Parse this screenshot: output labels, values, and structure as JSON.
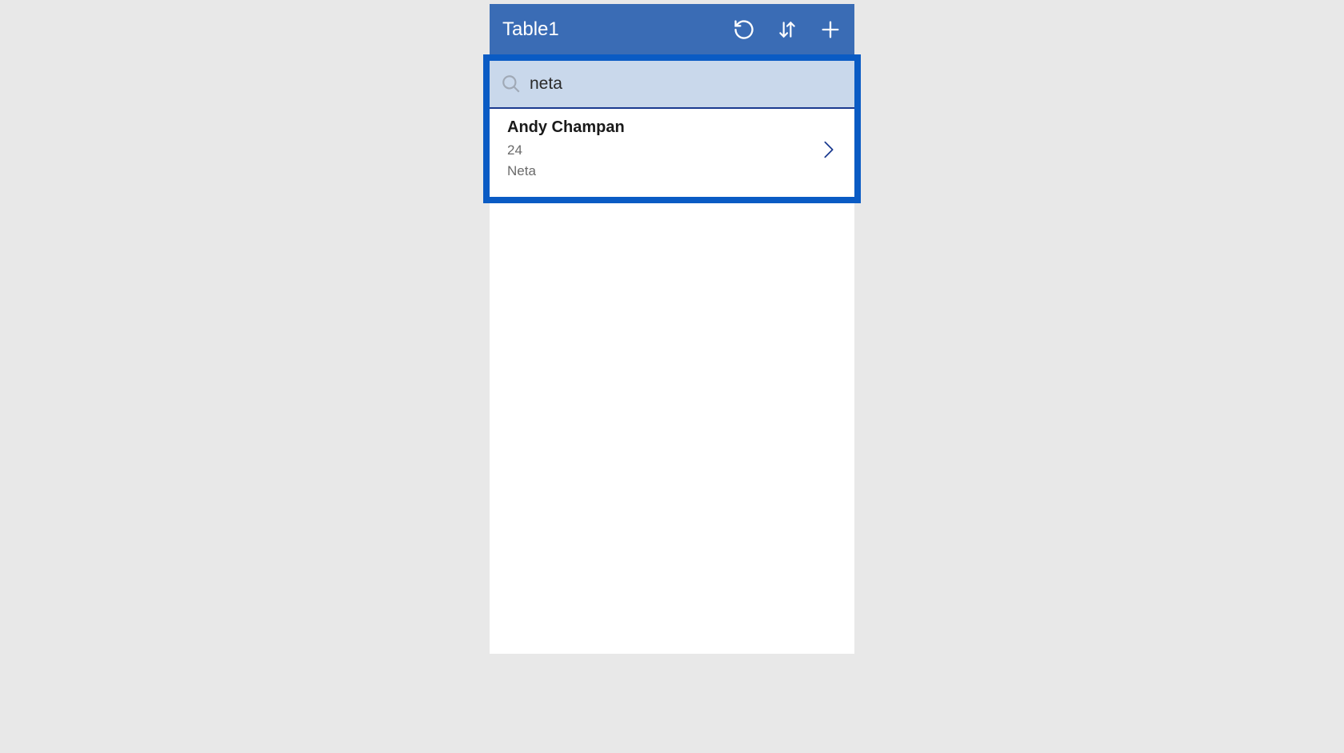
{
  "header": {
    "title": "Table1"
  },
  "search": {
    "value": "neta"
  },
  "results": [
    {
      "name": "Andy Champan",
      "age": "24",
      "company": "Neta"
    }
  ],
  "colors": {
    "headerBg": "#3a6cb5",
    "highlightBorder": "#0a5bc4",
    "searchBg": "#c9d8eb",
    "chevron": "#1a3a8f"
  }
}
